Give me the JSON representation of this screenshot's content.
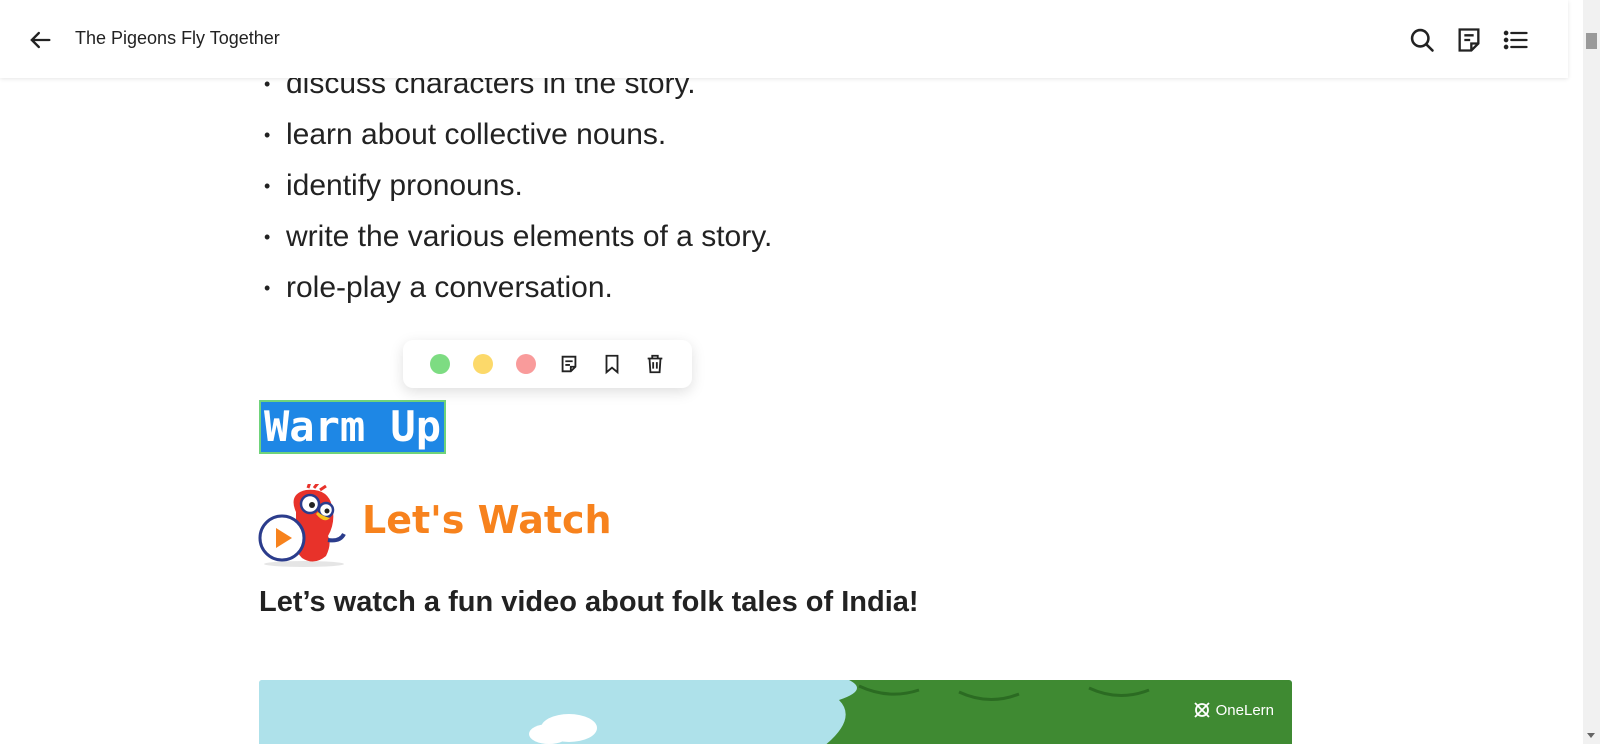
{
  "header": {
    "title": "The Pigeons Fly Together",
    "icons": [
      "back-arrow-icon",
      "search-icon",
      "notes-icon",
      "contents-list-icon"
    ]
  },
  "lesson": {
    "objectives": [
      "discuss characters in the story.",
      "learn about collective nouns.",
      "identify pronouns.",
      "write the various elements of a story.",
      "role-play a conversation."
    ],
    "section_heading": "Warm Up",
    "activity_title": "Let's Watch",
    "activity_description": "Let’s watch a fun video about folk tales of India!"
  },
  "highlight_toolbar": {
    "colors": [
      "#7ddc82",
      "#fcd96a",
      "#f99b9b"
    ],
    "icons": [
      "note-icon",
      "bookmark-icon",
      "trash-icon"
    ]
  },
  "video": {
    "brand": "OneLern"
  },
  "colors": {
    "selection": "#1e87e5",
    "selection_border": "#6fd37a",
    "activity_orange": "#f7821d"
  }
}
